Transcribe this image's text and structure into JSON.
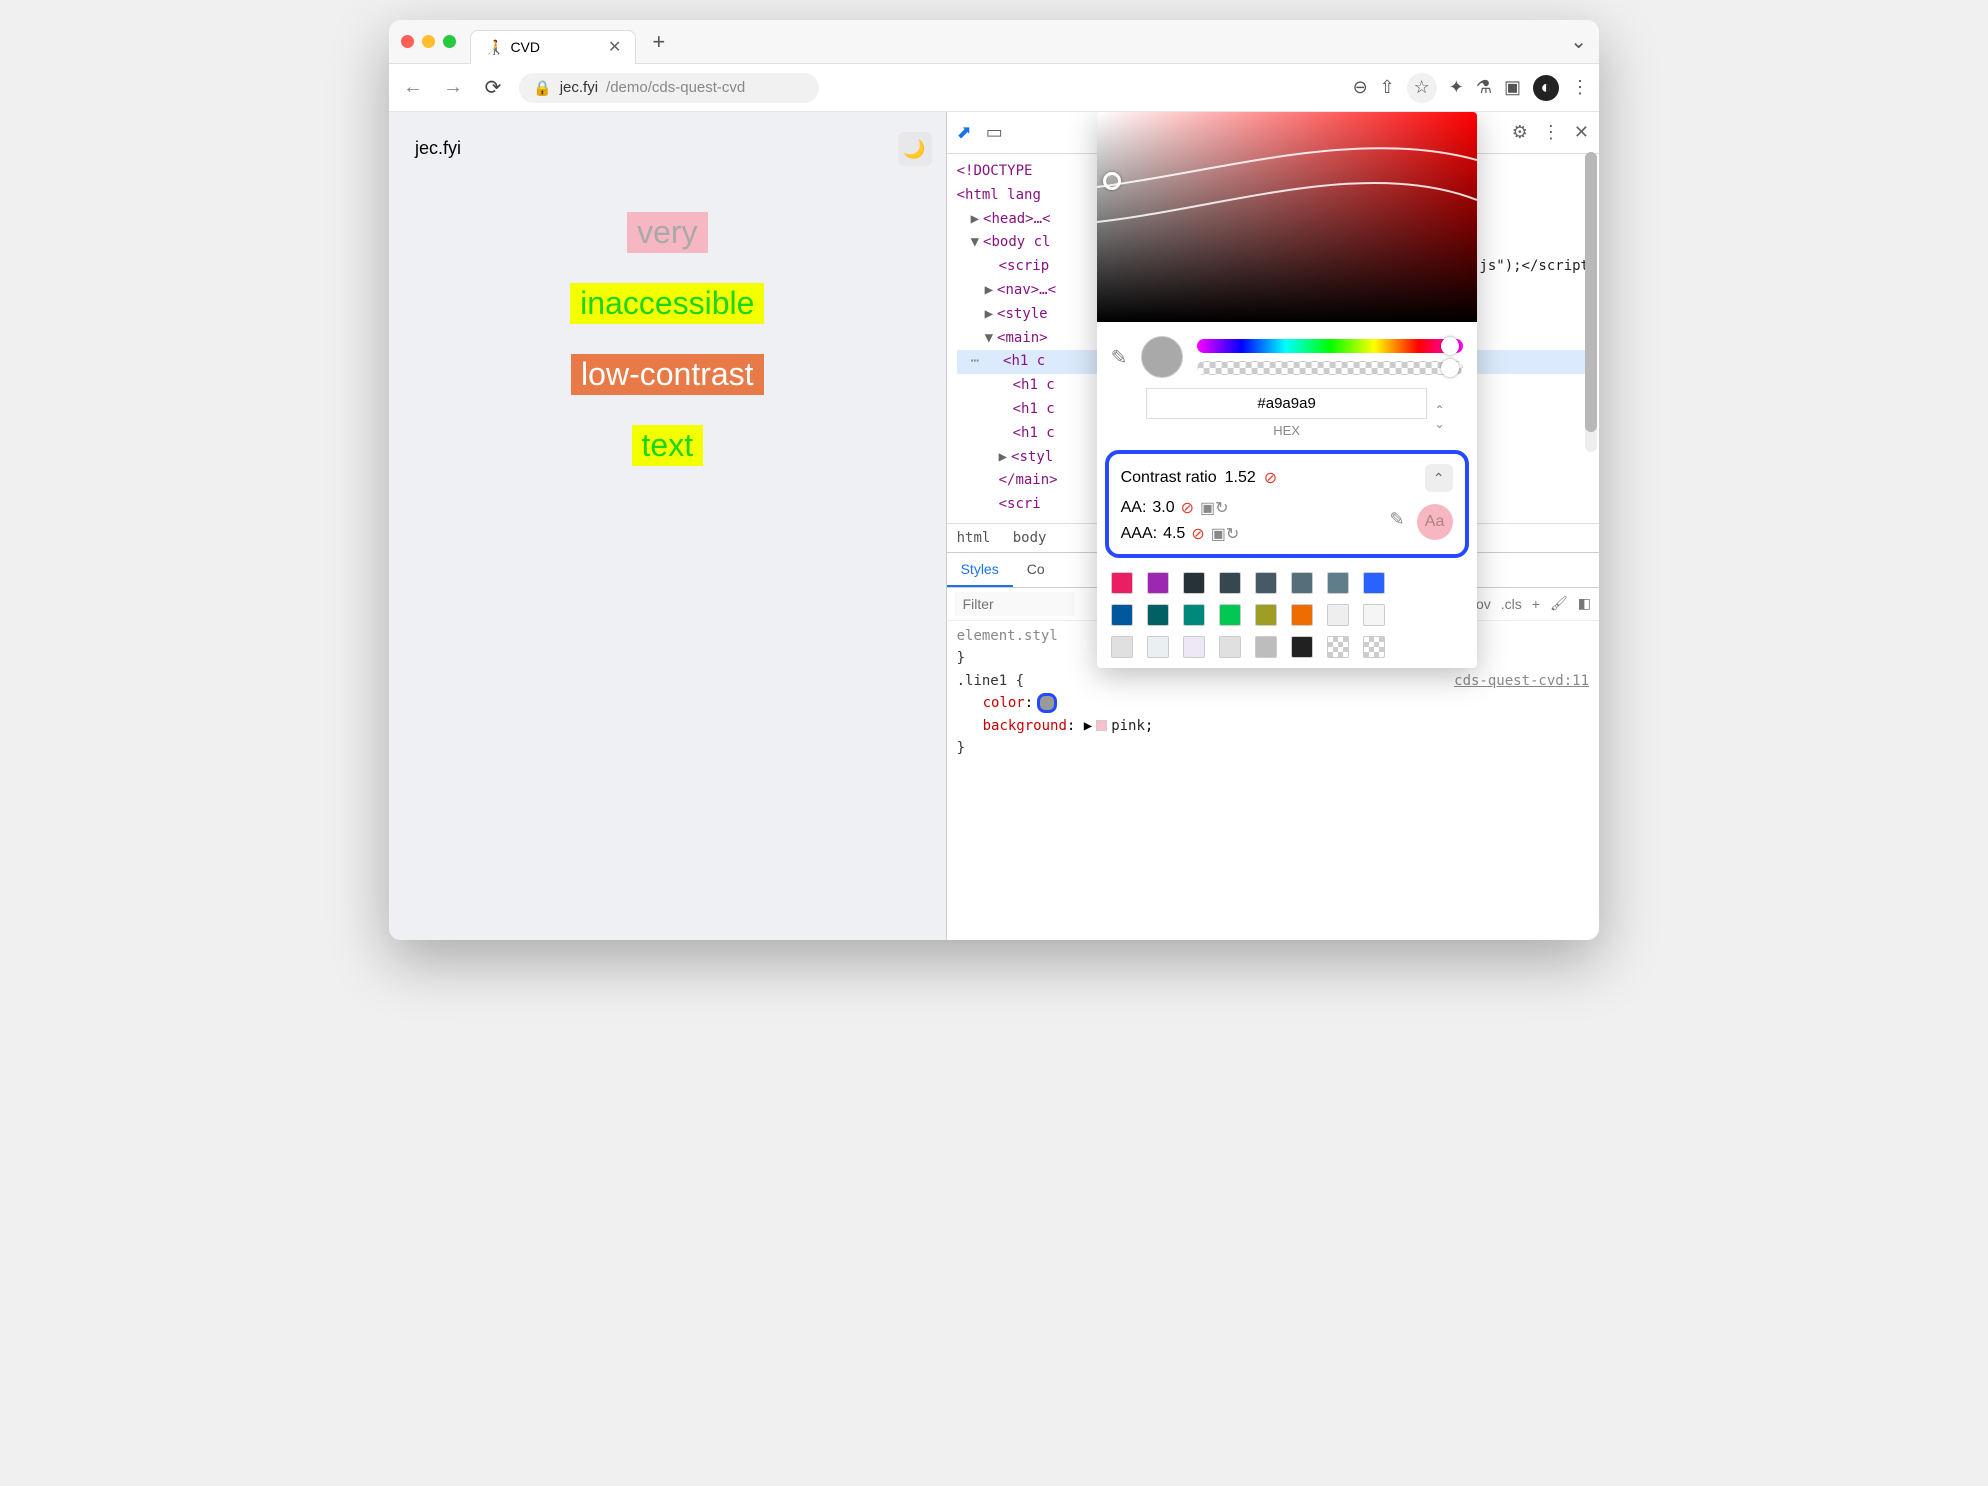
{
  "tab": {
    "title": "CVD"
  },
  "url": {
    "domain": "jec.fyi",
    "path": "/demo/cds-quest-cvd"
  },
  "page": {
    "brand": "jec.fyi",
    "samples": {
      "s1": "very",
      "s2": "inaccessible",
      "s3": "low-contrast",
      "s4": "text"
    }
  },
  "dom": {
    "doctype": "<!DOCTYPE",
    "htmlopen": "<html lang",
    "head": "<head>…<",
    "body": "<body cl",
    "script": "<scrip",
    "scriptend": "-js\");</script",
    "nav": "<nav>…<",
    "style": "<style",
    "mainopen": "<main>",
    "h1a": "<h1 c",
    "h1b": "<h1 c",
    "h1c": "<h1 c",
    "h1d": "<h1 c",
    "style2": "<styl",
    "mainclose": "</main>",
    "scri": "<scri"
  },
  "crumbs": {
    "html": "html",
    "body": "body"
  },
  "styles": {
    "tabs": {
      "styles": "Styles",
      "computed": "Co"
    },
    "filter": "Filter",
    "hov": ":hov",
    "cls": ".cls",
    "elstyle": "element.styl",
    "rule": ".line1 {",
    "propcolor": "color",
    "propbg": "background",
    "bgval": "pink",
    "close": "}",
    "source": "cds-quest-cvd:11"
  },
  "picker": {
    "hex": "#a9a9a9",
    "hexlabel": "HEX",
    "contrast_title": "Contrast ratio",
    "contrast_val": "1.52",
    "aa_label": "AA:",
    "aa_val": "3.0",
    "aaa_label": "AAA:",
    "aaa_val": "4.5",
    "aa_sample": "Aa",
    "palette_colors": [
      "#e91e63",
      "#9c27b0",
      "#263238",
      "#37474f",
      "#455a64",
      "#546e7a",
      "#607d8b",
      "#2962ff",
      "#01579b",
      "#006064",
      "#00897b",
      "#00c853",
      "#9e9d24",
      "#ef6c00",
      "#eeeeee",
      "#f5f5f5",
      "#e0e0e0",
      "#eaeff1",
      "#ede7f6",
      "#e0e0e0",
      "#bdbdbd",
      "#212121"
    ]
  }
}
